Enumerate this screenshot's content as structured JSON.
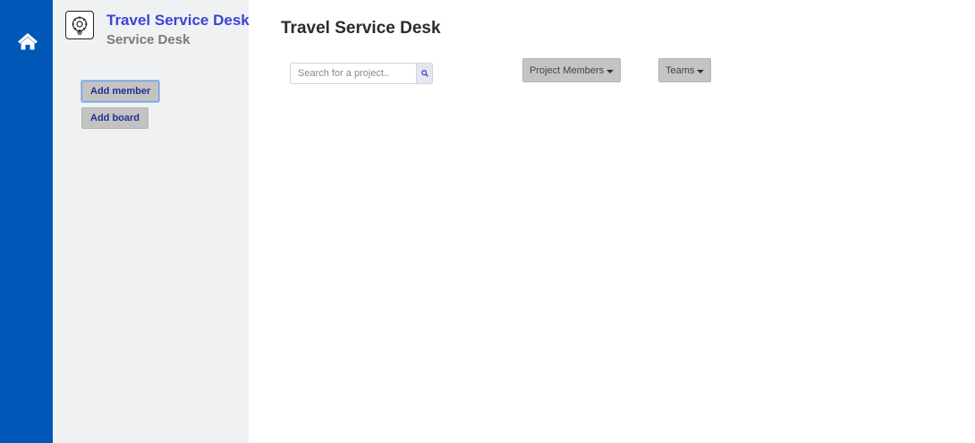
{
  "rail": {
    "home_icon": "home-icon"
  },
  "sidebar": {
    "project_icon": "gear-brain-icon",
    "project_name": "Travel Service Desk",
    "project_type": "Service Desk",
    "add_member_label": "Add member",
    "add_board_label": "Add board"
  },
  "main": {
    "title": "Travel Service Desk",
    "search": {
      "placeholder": "Search for a project..",
      "value": "",
      "icon": "search-icon"
    },
    "project_members_label": "Project Members",
    "teams_label": "Teams"
  },
  "colors": {
    "rail": "#0057b8",
    "sidebar": "#f0f1f3",
    "project_name": "#3a44d6",
    "button_text": "#1f2f8f"
  }
}
